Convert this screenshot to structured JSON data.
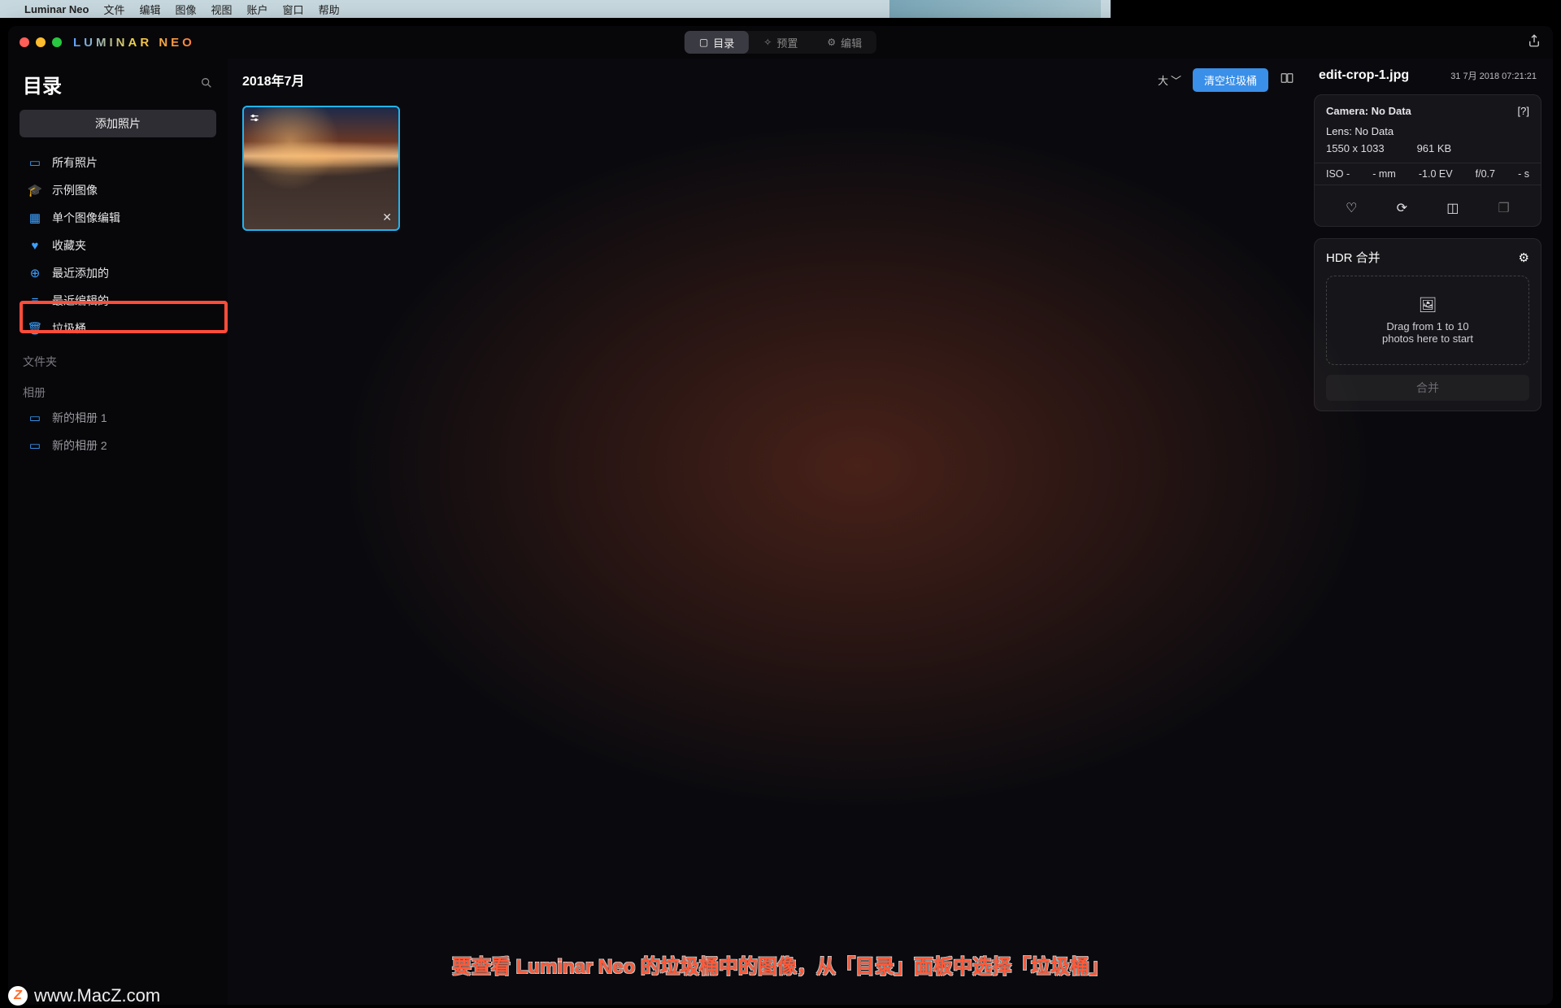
{
  "menubar": {
    "appname": "Luminar Neo",
    "items": [
      "文件",
      "编辑",
      "图像",
      "视图",
      "账户",
      "窗口",
      "帮助"
    ]
  },
  "brand": "LUMINAR NEO",
  "tabs": {
    "catalog": "目录",
    "presets": "预置",
    "edit": "编辑"
  },
  "sidebar": {
    "title": "目录",
    "add_photos": "添加照片",
    "items": [
      {
        "icon": "photos-icon",
        "label": "所有照片"
      },
      {
        "icon": "grad-cap-icon",
        "label": "示例图像"
      },
      {
        "icon": "grid-icon",
        "label": "单个图像编辑"
      },
      {
        "icon": "heart-icon",
        "label": "收藏夹"
      },
      {
        "icon": "plus-circle-icon",
        "label": "最近添加的"
      },
      {
        "icon": "sliders-icon",
        "label": "最近编辑的"
      },
      {
        "icon": "trash-icon",
        "label": "垃圾桶"
      }
    ],
    "folders_label": "文件夹",
    "albums_label": "相册",
    "albums": [
      "新的相册 1",
      "新的相册 2"
    ]
  },
  "main": {
    "group_date": "2018年7月",
    "size_selector": "大",
    "empty_trash": "清空垃圾桶"
  },
  "meta": {
    "filename": "edit-crop-1.jpg",
    "datetime": "31 7月 2018 07:21:21",
    "camera_label": "Camera: No Data",
    "lens_label": "Lens: No Data",
    "dimensions": "1550 x 1033",
    "filesize": "961 KB",
    "iso": "ISO -",
    "focal": "- mm",
    "ev": "-1.0 EV",
    "aperture": "f/0.7",
    "shutter": "- s"
  },
  "hdr": {
    "title": "HDR 合并",
    "drop1": "Drag from 1 to 10",
    "drop2": "photos here to start",
    "merge": "合并"
  },
  "caption": "要查看 Luminar Neo 的垃圾桶中的图像，从「目录」面板中选择「垃圾桶」",
  "watermark": "www.MacZ.com"
}
